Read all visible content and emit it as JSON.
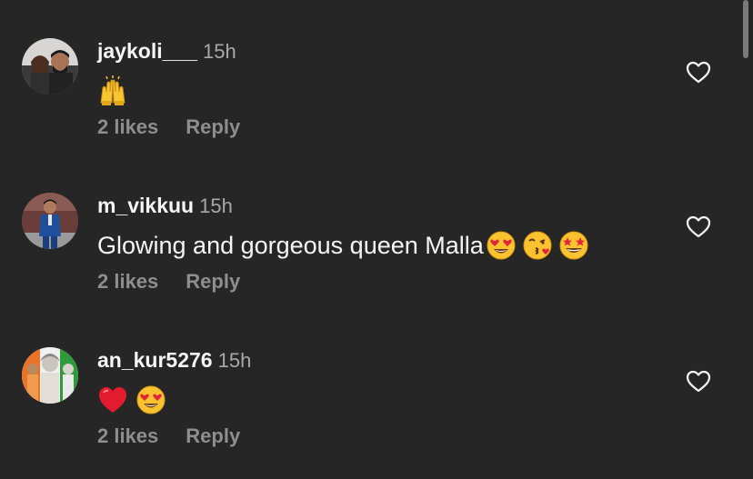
{
  "comments": [
    {
      "username": "jaykoli___",
      "time": "15h",
      "text": "",
      "emojis": [
        "raising-hands"
      ],
      "likes": "2 likes",
      "reply": "Reply"
    },
    {
      "username": "m_vikkuu",
      "time": "15h",
      "text": "Glowing and gorgeous queen Malla",
      "emojis": [
        "heart-eyes",
        "kissing-face",
        "star-struck"
      ],
      "likes": "2 likes",
      "reply": "Reply"
    },
    {
      "username": "an_kur5276",
      "time": "15h",
      "text": "",
      "emojis": [
        "red-heart",
        "heart-eyes"
      ],
      "likes": "2 likes",
      "reply": "Reply"
    }
  ],
  "colors": {
    "background": "#262626",
    "text": "#f5f5f5",
    "muted": "#a8a8a8",
    "action": "#8e8e8e"
  },
  "icons": {
    "like": "heart-outline-icon"
  }
}
